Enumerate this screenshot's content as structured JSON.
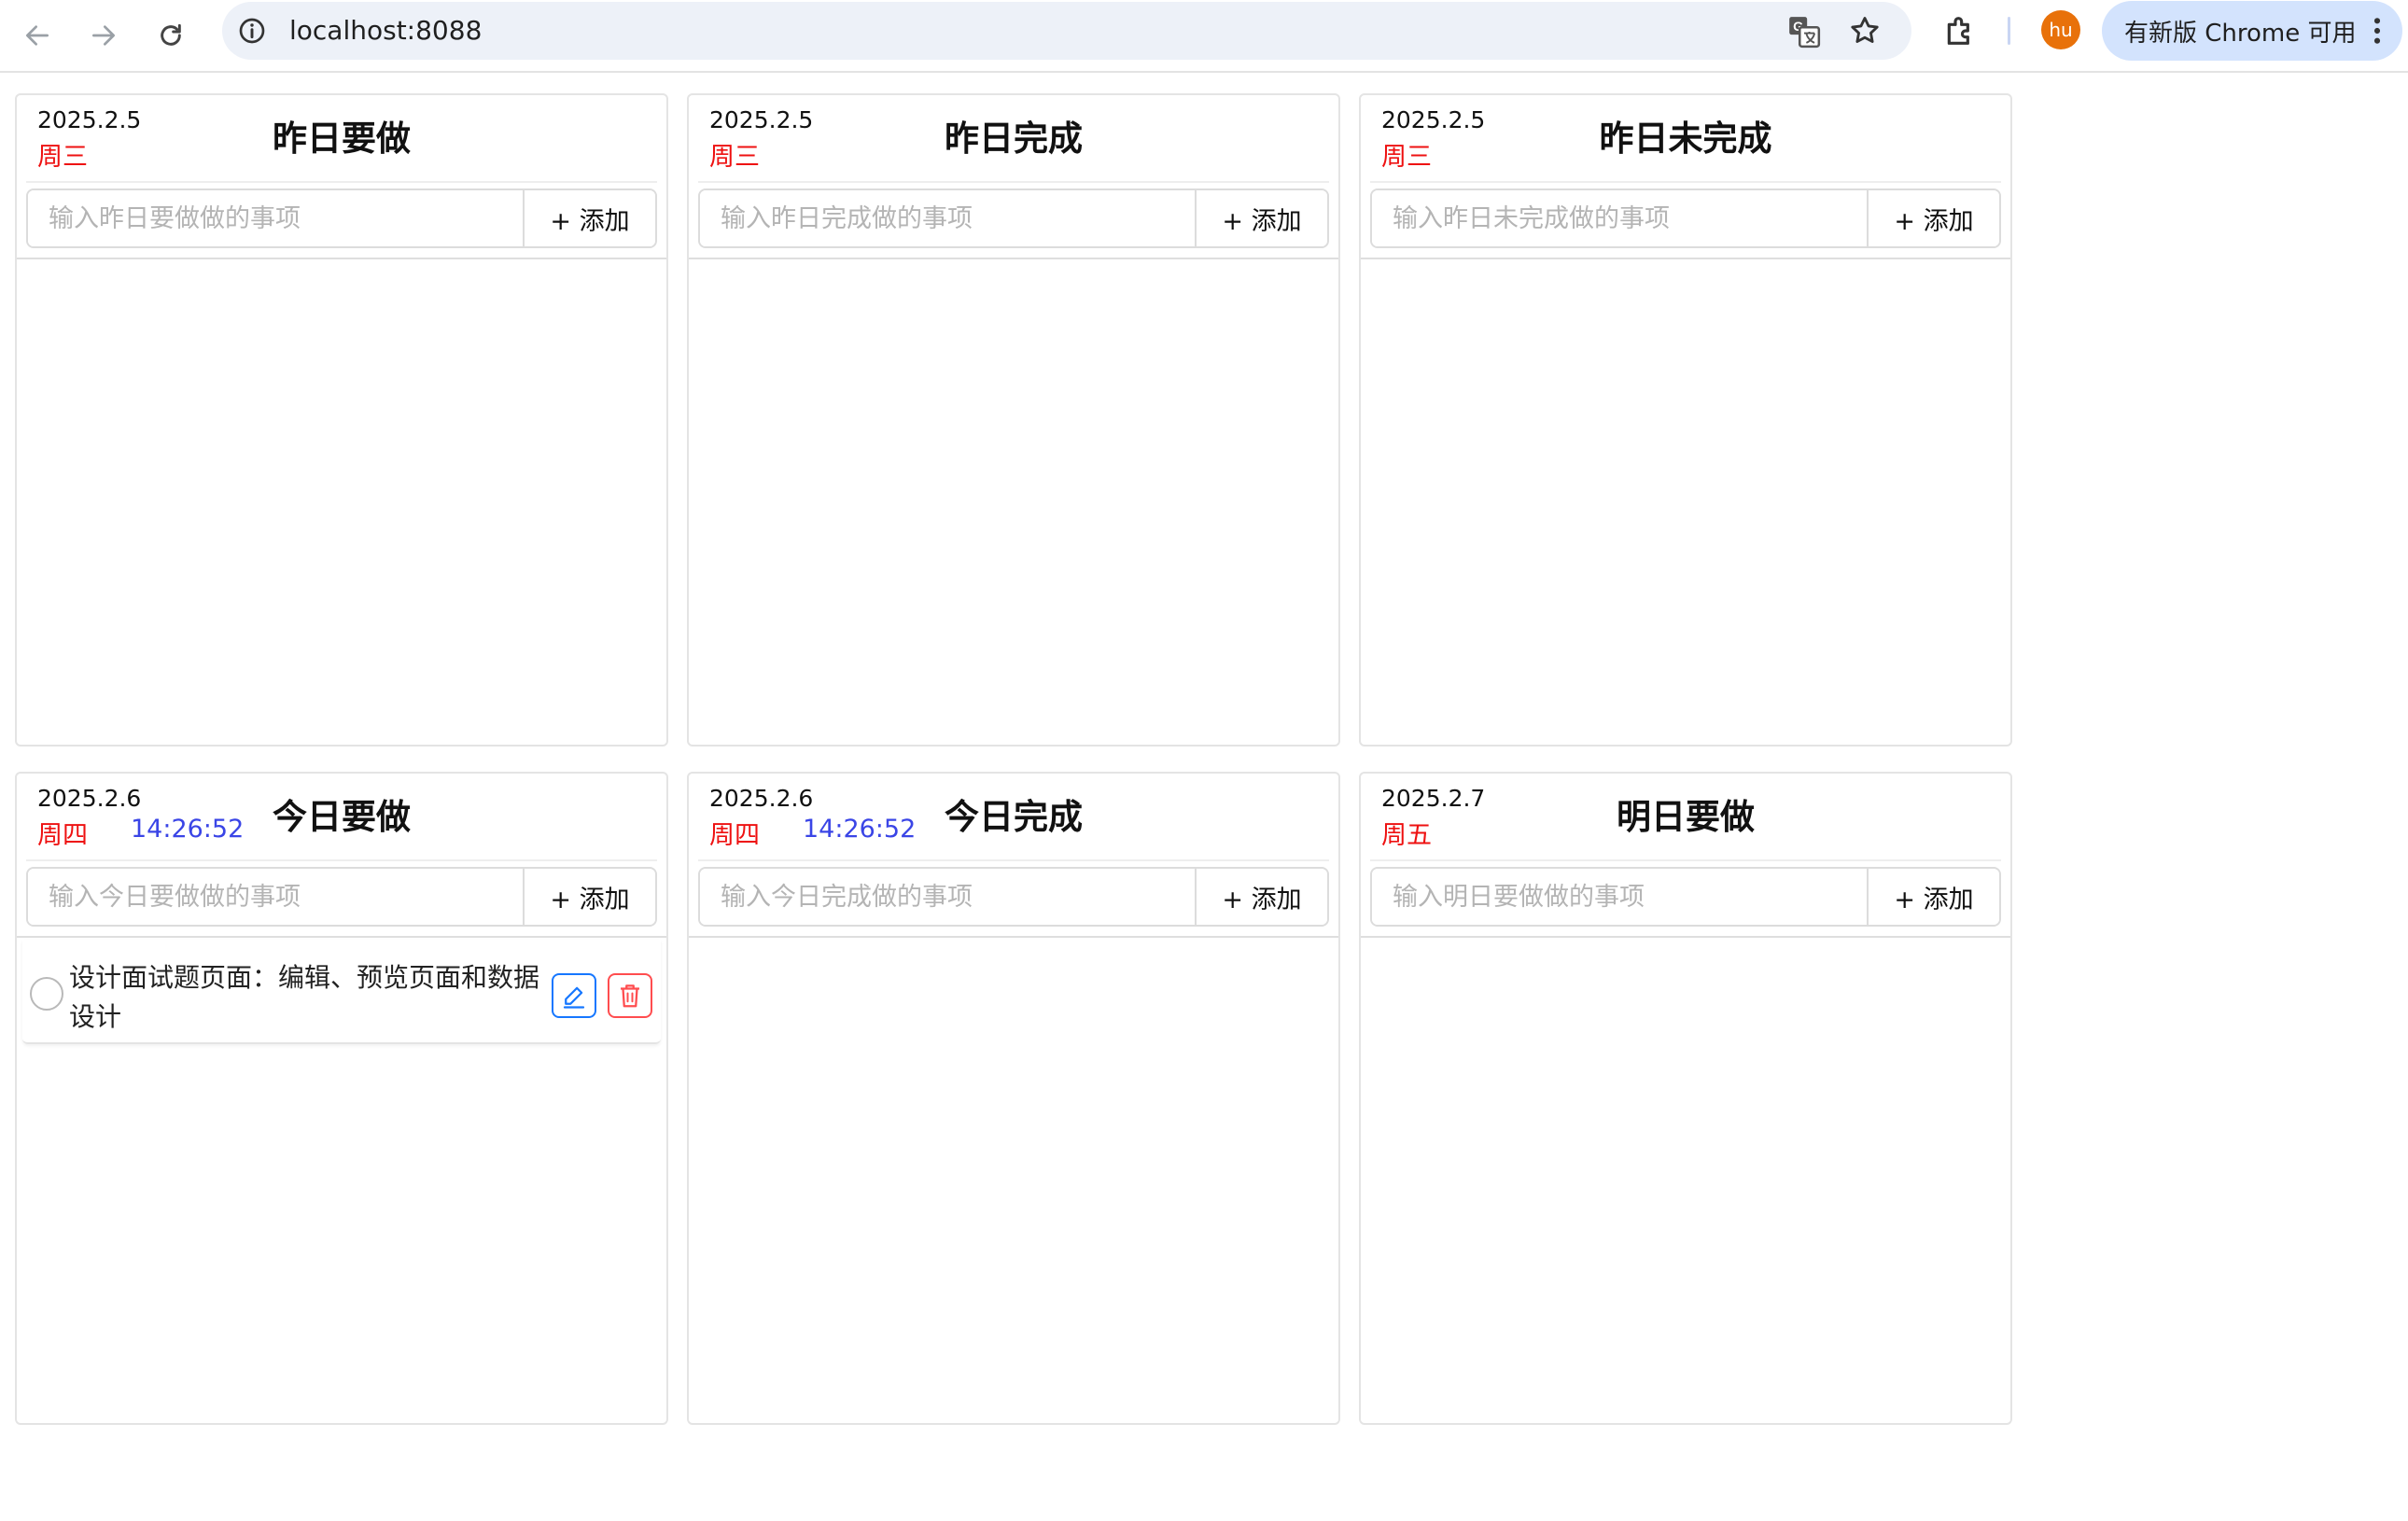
{
  "browser": {
    "url": "localhost:8088",
    "avatar": "hu",
    "update_label": "有新版 Chrome 可用",
    "icons": [
      "back-arrow-icon",
      "forward-arrow-icon",
      "reload-icon",
      "site-info-icon",
      "translate-icon",
      "bookmark-star-icon",
      "extensions-icon",
      "menu-kebab-icon"
    ]
  },
  "cards": [
    {
      "date": "2025.2.5",
      "weekday": "周三",
      "time": "",
      "title": "昨日要做",
      "placeholder": "输入昨日要做做的事项",
      "add_label": "+ 添加"
    },
    {
      "date": "2025.2.5",
      "weekday": "周三",
      "time": "",
      "title": "昨日完成",
      "placeholder": "输入昨日完成做的事项",
      "add_label": "+ 添加"
    },
    {
      "date": "2025.2.5",
      "weekday": "周三",
      "time": "",
      "title": "昨日未完成",
      "placeholder": "输入昨日未完成做的事项",
      "add_label": "+ 添加"
    },
    {
      "date": "2025.2.6",
      "weekday": "周四",
      "time": "14:26:52",
      "title": "今日要做",
      "placeholder": "输入今日要做做的事项",
      "add_label": "+ 添加",
      "tasks": [
        {
          "text": "设计面试题页面：编辑、预览页面和数据设计"
        }
      ]
    },
    {
      "date": "2025.2.6",
      "weekday": "周四",
      "time": "14:26:52",
      "title": "今日完成",
      "placeholder": "输入今日完成做的事项",
      "add_label": "+ 添加"
    },
    {
      "date": "2025.2.7",
      "weekday": "周五",
      "time": "",
      "title": "明日要做",
      "placeholder": "输入明日要做做的事项",
      "add_label": "+ 添加"
    }
  ],
  "colors": {
    "weekday": "#ee1111",
    "time": "#3a45e6",
    "edit": "#1677ff",
    "delete": "#ff4d4f"
  }
}
